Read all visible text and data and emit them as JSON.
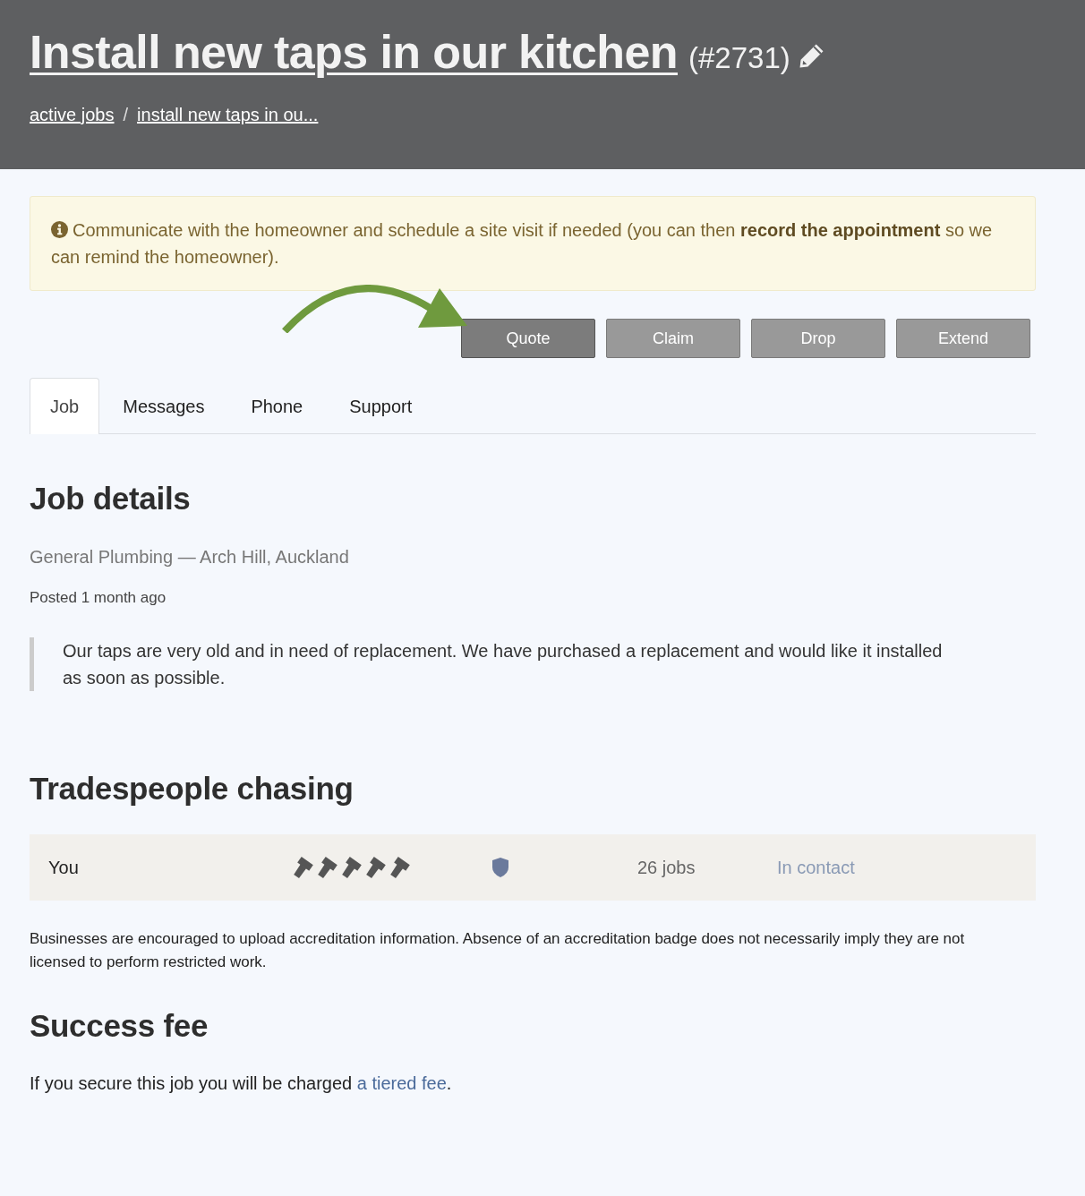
{
  "header": {
    "title": "Install new taps in our kitchen",
    "job_number": "(#2731)",
    "breadcrumbs": [
      {
        "label": "active jobs"
      },
      {
        "label": "install new taps in ou..."
      }
    ],
    "breadcrumb_separator": "/"
  },
  "alert": {
    "text": "Communicate with the homeowner and schedule a site visit if needed (you can then **record the appointment** so we can remind the homeowner)."
  },
  "actions": [
    {
      "label": "Quote",
      "highlighted": true
    },
    {
      "label": "Claim",
      "highlighted": false
    },
    {
      "label": "Drop",
      "highlighted": false
    },
    {
      "label": "Extend",
      "highlighted": false
    }
  ],
  "tabs": [
    {
      "label": "Job",
      "selected": true
    },
    {
      "label": "Messages",
      "selected": false
    },
    {
      "label": "Phone",
      "selected": false
    },
    {
      "label": "Support",
      "selected": false
    }
  ],
  "job_details": {
    "heading": "Job details",
    "category": "General Plumbing — Arch Hill, Auckland",
    "posted": "Posted 1 month ago",
    "description": "Our taps are very old and in need of replacement. We have purchased a replacement and would like it installed as soon as possible."
  },
  "tradespeople": {
    "heading": "Tradespeople chasing",
    "rows": [
      {
        "name": "You",
        "stars": 5,
        "accredited": true,
        "jobs": "26 jobs",
        "status": "In contact"
      }
    ],
    "note": "Businesses are encouraged to upload accreditation information. Absence of an accreditation badge does not necessarily imply they are not licensed to perform restricted work."
  },
  "success_fee": {
    "heading": "Success fee",
    "text": "If you secure this job you will be charged ",
    "link": "a tiered fee",
    "after": "."
  }
}
